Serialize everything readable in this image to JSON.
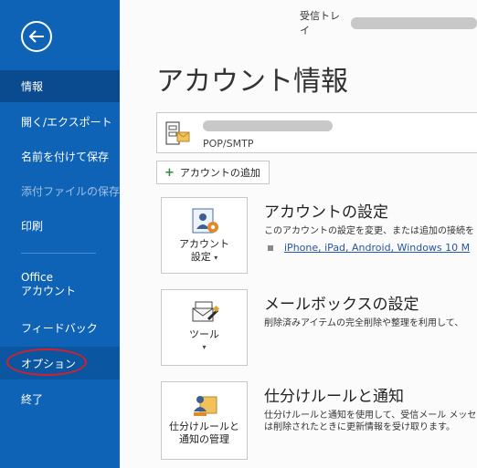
{
  "sidebar": {
    "items": [
      {
        "label": "情報"
      },
      {
        "label": "開く/エクスポート"
      },
      {
        "label": "名前を付けて保存"
      },
      {
        "label": "添付ファイルの保存"
      },
      {
        "label": "印刷"
      },
      {
        "label_line1": "Office",
        "label_line2": "アカウント"
      },
      {
        "label": "フィードバック"
      },
      {
        "label": "オプション"
      },
      {
        "label": "終了"
      }
    ]
  },
  "header": {
    "inbox_label": "受信トレイ"
  },
  "main": {
    "title": "アカウント情報",
    "account": {
      "type": "POP/SMTP"
    },
    "add_account_label": "アカウントの追加",
    "sections": [
      {
        "tile_line1": "アカウント",
        "tile_line2": "設定",
        "heading": "アカウントの設定",
        "desc1": "このアカウントの設定を変更、または追加の接続を",
        "link": "iPhone, iPad, Android, Windows 10 M"
      },
      {
        "tile_line1": "ツール",
        "heading": "メールボックスの設定",
        "desc1": "削除済みアイテムの完全削除や整理を利用して、"
      },
      {
        "tile_line1": "仕分けルールと",
        "tile_line2": "通知の管理",
        "heading": "仕分けルールと通知",
        "desc1": "仕分けルールと通知を使用して、受信メール メッセ",
        "desc2": "は削除されたときに更新情報を受け取ります。"
      }
    ]
  }
}
